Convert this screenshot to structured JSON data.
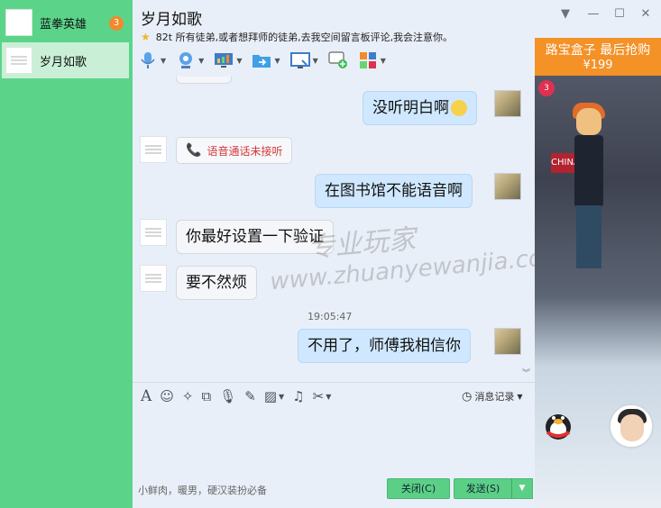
{
  "sidebar": {
    "contacts": [
      {
        "name": "蓝拳英雄",
        "unread": "3"
      },
      {
        "name": "岁月如歌"
      }
    ]
  },
  "header": {
    "title": "岁月如歌",
    "signature": "82t 所有徒弟,或者想拜师的徒弟,去我空间留言板评论,我会注意你。"
  },
  "toolbar": {
    "icons": [
      "voice-call-icon",
      "video-call-icon",
      "remote-desktop-icon",
      "send-file-icon",
      "screen-share-icon",
      "add-friend-icon",
      "apps-icon"
    ]
  },
  "messages": [
    {
      "direction": "out",
      "text": "没听明白啊"
    },
    {
      "direction": "in",
      "type": "call",
      "text": "语音通话未接听"
    },
    {
      "direction": "out",
      "text": "在图书馆不能语音啊"
    },
    {
      "direction": "in",
      "text": "你最好设置一下验证"
    },
    {
      "direction": "in",
      "text": "要不然烦"
    },
    {
      "type": "timestamp",
      "text": "19:05:47"
    },
    {
      "direction": "out",
      "text": "不用了，师傅我相信你"
    }
  ],
  "watermark": {
    "line1": "专业玩家",
    "line2": "www.zhuanyewanjia.com"
  },
  "input": {
    "placeholder": "小鲜肉，暖男，硬汉装扮必备",
    "history_label": "消息记录",
    "close_label": "关闭(C)",
    "send_label": "发送(S)"
  },
  "ad": {
    "headline": "路宝盒子 最后抢购",
    "price": "¥199",
    "badge": "3",
    "sign_text": "CHINA"
  },
  "colors": {
    "sidebar": "#5bd48a",
    "out_bubble": "#cfe8ff",
    "button": "#5ccf87",
    "ad_banner": "#f49127"
  }
}
